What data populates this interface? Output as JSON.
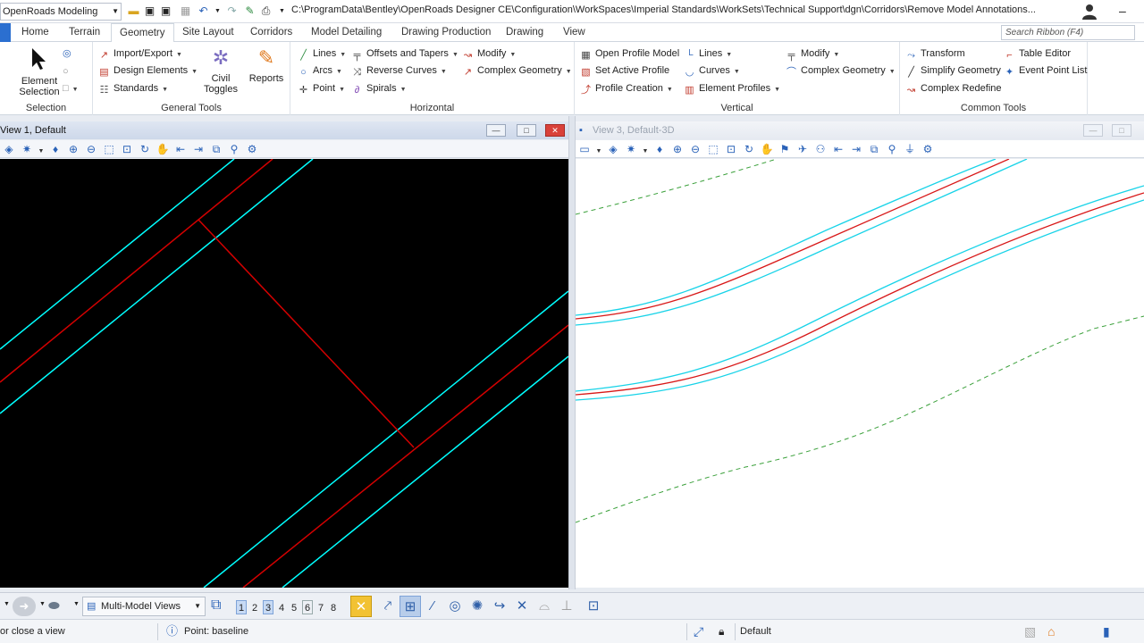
{
  "workflow": "OpenRoads Modeling",
  "file_path": "C:\\ProgramData\\Bentley\\OpenRoads Designer CE\\Configuration\\WorkSpaces\\Imperial Standards\\WorkSets\\Technical Support\\dgn\\Corridors\\Remove Model Annotations...",
  "tabs": [
    "Home",
    "Terrain",
    "Geometry",
    "Site Layout",
    "Corridors",
    "Model Detailing",
    "Drawing Production",
    "Drawing",
    "View"
  ],
  "search_placeholder": "Search Ribbon (F4)",
  "ribbon": {
    "selection": {
      "label": "Selection",
      "element_selection": "Element Selection"
    },
    "general_tools": {
      "label": "General Tools",
      "import_export": "Import/Export",
      "design_elements": "Design Elements",
      "standards": "Standards",
      "civil_toggles": "Civil Toggles",
      "reports": "Reports"
    },
    "horizontal": {
      "label": "Horizontal",
      "lines": "Lines",
      "arcs": "Arcs",
      "point": "Point",
      "offsets_tapers": "Offsets and Tapers",
      "reverse_curves": "Reverse Curves",
      "spirals": "Spirals",
      "modify": "Modify",
      "complex_geometry": "Complex Geometry"
    },
    "vertical": {
      "label": "Vertical",
      "open_profile": "Open Profile Model",
      "set_active_profile": "Set Active Profile",
      "profile_creation": "Profile Creation",
      "lines": "Lines",
      "curves": "Curves",
      "element_profiles": "Element Profiles",
      "modify": "Modify",
      "complex_geometry": "Complex Geometry"
    },
    "common_tools": {
      "label": "Common Tools",
      "transform": "Transform",
      "simplify_geometry": "Simplify Geometry",
      "complex_redefine": "Complex Redefine",
      "table_editor": "Table Editor",
      "event_point_list": "Event Point List"
    }
  },
  "view1": {
    "title": "View 1, Default"
  },
  "view3": {
    "title": "View 3, Default-3D"
  },
  "bottom": {
    "multi_model_views": "Multi-Model Views",
    "view_numbers": [
      "1",
      "2",
      "3",
      "4",
      "5",
      "6",
      "7",
      "8"
    ]
  },
  "status": {
    "left": "or close a view",
    "prompt": "Point: baseline",
    "level": "Default"
  },
  "colors": {
    "cyan": "#00ffff",
    "red": "#d40000",
    "view3_cyan": "#18d3e8",
    "view3_red": "#d81818",
    "green_dash": "#3aa03a"
  }
}
